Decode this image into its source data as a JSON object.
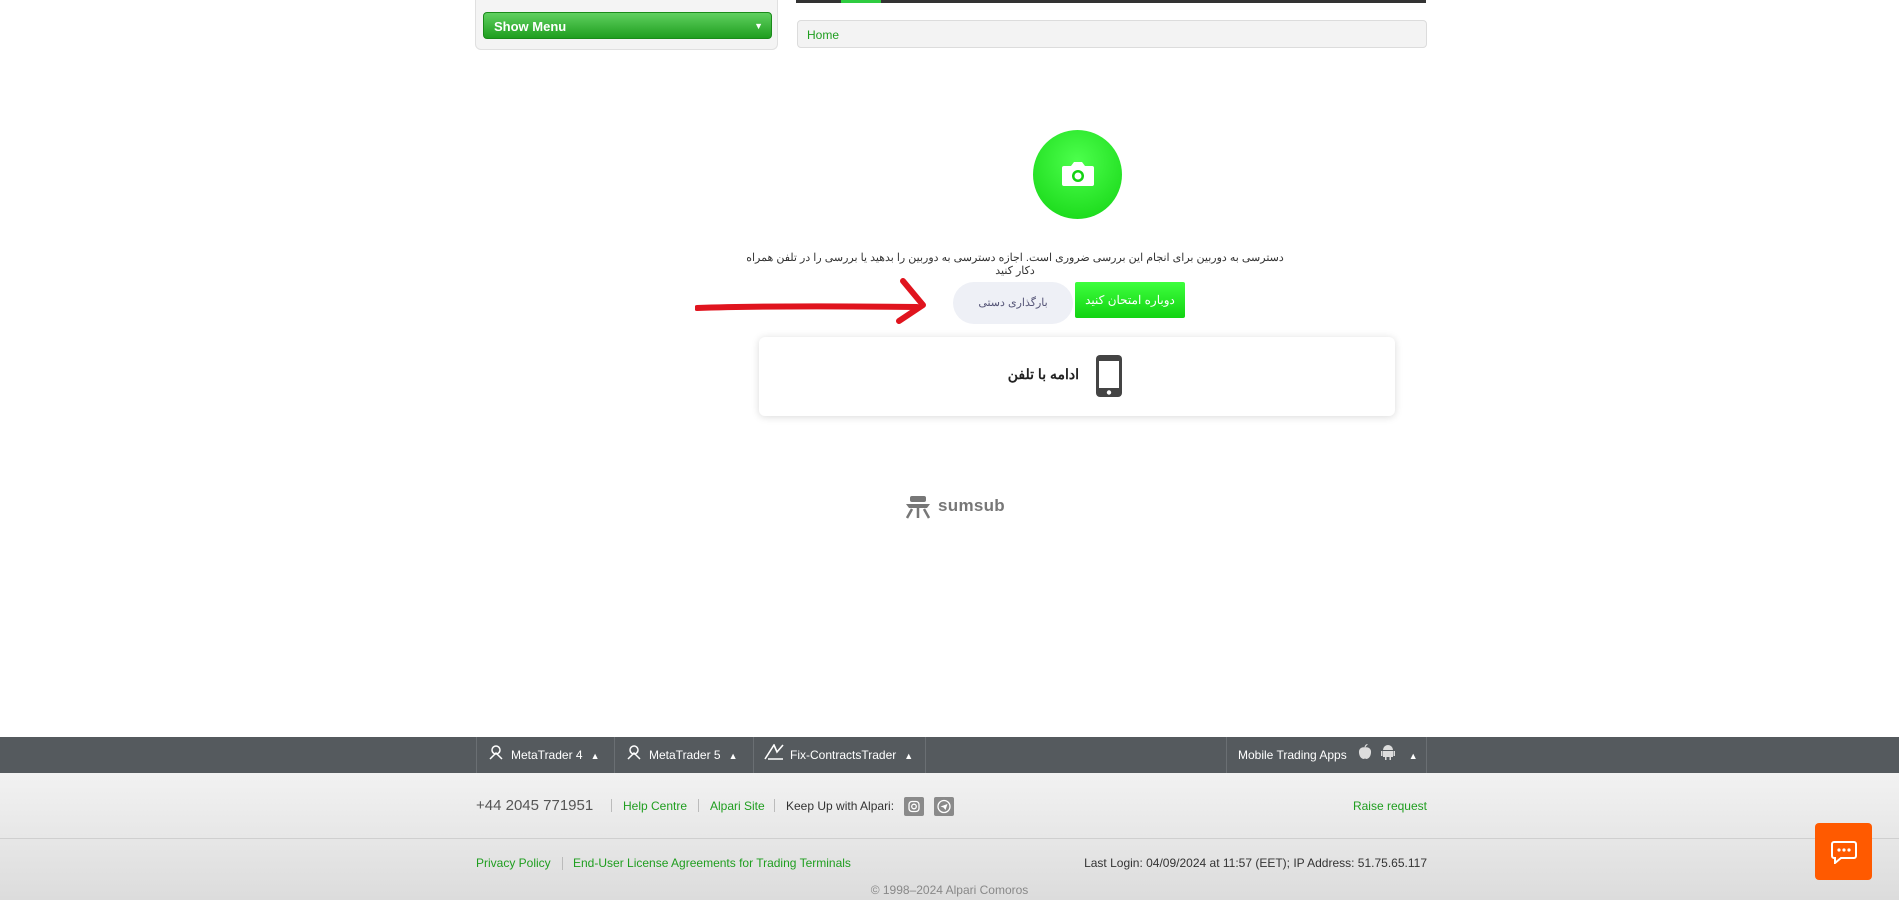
{
  "header": {
    "menu_button": "Show Menu",
    "menu_arrow": "▼",
    "breadcrumb_home": "Home"
  },
  "verification": {
    "message": "دسترسی به دوربین برای انجام این بررسی ضروری است. اجازه دسترسی به دوربین را بدهید یا بررسی را در تلفن همراه دکار کنید",
    "retry_button": "دوباره امتحان کنید",
    "manual_upload_button": "بارگذاری دستی",
    "continue_phone": "ادامه با تلفن",
    "brand": "sumsub",
    "accent_color": "#12d312",
    "annotation_color": "#e0141e"
  },
  "footer": {
    "platforms": [
      {
        "label": "MetaTrader 4",
        "icon": "metatrader-icon"
      },
      {
        "label": "MetaTrader 5",
        "icon": "metatrader-icon"
      },
      {
        "label": "Fix-ContractsTrader",
        "icon": "fix-icon"
      }
    ],
    "mobile_apps": "Mobile Trading Apps",
    "arrow_up": "▲",
    "phone": "+44 2045 771951",
    "help_centre": "Help Centre",
    "alpari_site": "Alpari Site",
    "keep_up": "Keep Up with Alpari:",
    "raise_request": "Raise request",
    "privacy_policy": "Privacy Policy",
    "eula": "End-User License Agreements for Trading Terminals",
    "last_login": "Last Login: 04/09/2024 at 11:57 (EET); IP Address: 51.75.65.117",
    "copyright": "© 1998–2024 Alpari Comoros"
  }
}
